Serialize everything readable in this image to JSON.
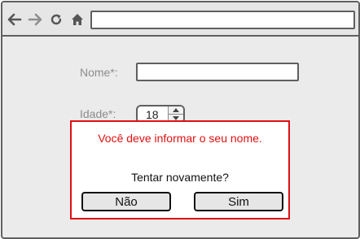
{
  "browser": {
    "back_icon": "arrow-left",
    "forward_icon": "arrow-right",
    "reload_icon": "reload",
    "home_icon": "house",
    "address_value": ""
  },
  "form": {
    "name_label": "Nome*:",
    "name_value": "",
    "age_label": "Idade*:",
    "age_value": "18"
  },
  "dialog": {
    "message": "Você deve informar o seu nome.",
    "question": "Tentar novamente?",
    "no_label": "Não",
    "yes_label": "Sim",
    "border_color": "#e01010"
  }
}
